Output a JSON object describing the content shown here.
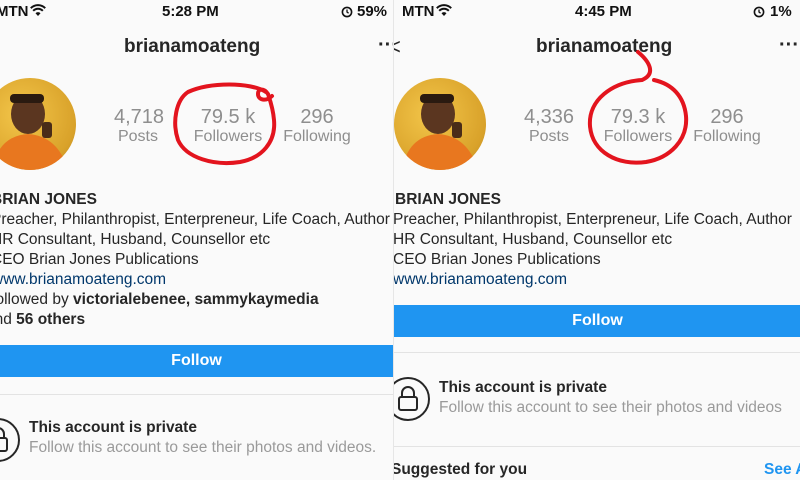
{
  "left": {
    "status": {
      "carrier": "MTN",
      "time": "5:28 PM",
      "battery": "59%"
    },
    "username": "brianamoateng",
    "more_label": "···",
    "stats": {
      "posts": {
        "value": "4,718",
        "label": "Posts"
      },
      "followers": {
        "value": "79.5 k",
        "label": "Followers"
      },
      "following": {
        "value": "296",
        "label": "Following"
      }
    },
    "bio": {
      "name": "BRIAN JONES",
      "line1": "Preacher, Philanthropist, Enterpreneur, Life Coach, Author",
      "line2": "HR Consultant, Husband, Counsellor etc",
      "line3": "CEO Brian Jones Publications",
      "website": "www.brianamoateng.com",
      "followed_prefix": "Followed by ",
      "followed_names": "victorialebenee, sammykaymedia",
      "followed_suffix_prefix": "and ",
      "followed_others": "56 others"
    },
    "follow_label": "Follow",
    "private": {
      "title": "This account is private",
      "subtitle": "Follow this account to see their photos and videos."
    }
  },
  "right": {
    "status": {
      "carrier": "MTN",
      "time": "4:45 PM",
      "battery": "1%"
    },
    "username": "brianamoateng",
    "back_label": "<",
    "more_label": "···",
    "stats": {
      "posts": {
        "value": "4,336",
        "label": "Posts"
      },
      "followers": {
        "value": "79.3 k",
        "label": "Followers"
      },
      "following": {
        "value": "296",
        "label": "Following"
      }
    },
    "bio": {
      "name": "BRIAN JONES",
      "line1": "Preacher, Philanthropist, Enterpreneur, Life Coach, Author",
      "line2": "HR Consultant, Husband, Counsellor etc",
      "line3": "CEO Brian Jones Publications",
      "website": "www.brianamoateng.com"
    },
    "follow_label": "Follow",
    "private": {
      "title": "This account is private",
      "subtitle": "Follow this account to see their photos and videos"
    },
    "suggested": {
      "title": "Suggested for you",
      "see_all": "See All"
    }
  },
  "colors": {
    "follow_blue": "#1f95f1",
    "annotation_red": "#e3141e",
    "link_blue": "#00376b"
  },
  "icons": [
    "wifi-icon",
    "alarm-icon",
    "lock-icon",
    "avatar-photo",
    "more-icon",
    "back-icon"
  ]
}
